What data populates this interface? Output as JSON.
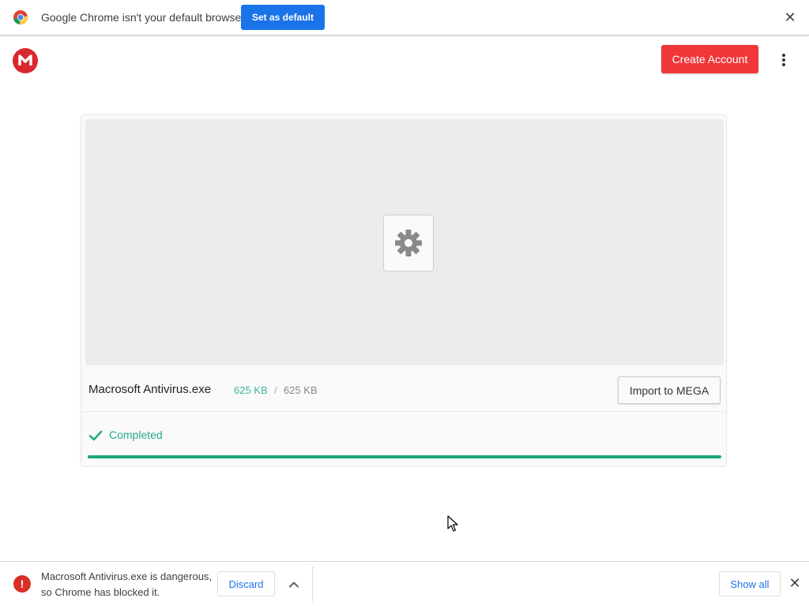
{
  "infobar": {
    "icon": "chrome-logo-icon",
    "message": "Google Chrome isn't your default browser",
    "set_default_label": "Set as default",
    "close_icon": "close-icon"
  },
  "header": {
    "logo_icon": "mega-logo-icon",
    "logo_letter": "M",
    "create_account_label": "Create Account",
    "menu_icon": "kebab-menu-icon",
    "accent_color": "#f0373a"
  },
  "download": {
    "file_name": "Macrosoft Antivirus.exe",
    "downloaded_size": "625 KB",
    "separator": "/",
    "total_size": "625 KB",
    "file_type_icon": "gear-icon",
    "import_label": "Import to MEGA",
    "status_icon": "checkmark-icon",
    "status_text": "Completed",
    "progress_fraction": 1.0,
    "progress_color": "#1fa67a"
  },
  "shelf": {
    "warning_icon": "danger-icon",
    "warning_glyph": "!",
    "message_line1": "Macrosoft Antivirus.exe is dangerous,",
    "message_line2": "so Chrome has blocked it.",
    "discard_label": "Discard",
    "chevron_icon": "chevron-up-icon",
    "show_all_label": "Show all",
    "close_icon": "close-icon"
  }
}
